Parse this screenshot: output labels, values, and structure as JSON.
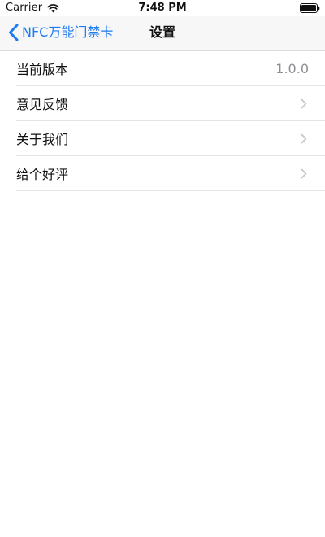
{
  "status_bar": {
    "carrier": "Carrier",
    "time": "7:48 PM",
    "icons": [
      "wifi-icon",
      "battery-icon"
    ]
  },
  "nav_bar": {
    "back_label": "NFC万能门禁卡",
    "title": "设置",
    "back_icon": "chevron-left-icon"
  },
  "colors": {
    "accent": "#1d7bf2",
    "nav_background": "#f7f7f7",
    "separator": "#e4e4e4",
    "secondary_text": "#8e8e93",
    "chevron": "#c4c4c7"
  },
  "settings_list": {
    "items": [
      {
        "label": "当前版本",
        "value": "1.0.0"
      },
      {
        "label": "意见反馈",
        "icon": "chevron-right-icon"
      },
      {
        "label": "关于我们",
        "icon": "chevron-right-icon"
      },
      {
        "label": "给个好评",
        "icon": "chevron-right-icon"
      }
    ]
  }
}
